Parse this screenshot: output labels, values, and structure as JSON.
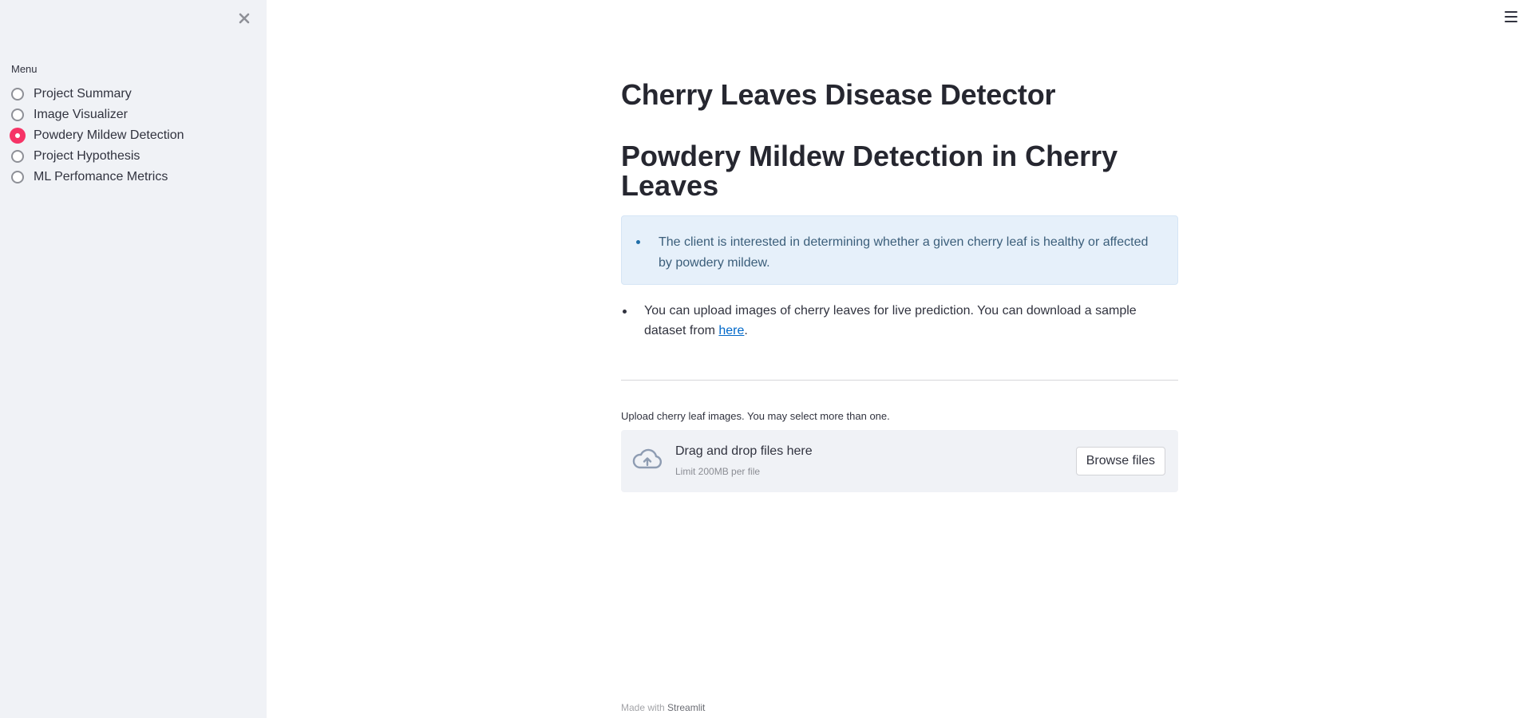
{
  "sidebar": {
    "close_icon": "close-icon",
    "menu_label": "Menu",
    "items": [
      {
        "label": "Project Summary",
        "selected": false
      },
      {
        "label": "Image Visualizer",
        "selected": false
      },
      {
        "label": "Powdery Mildew Detection",
        "selected": true
      },
      {
        "label": "Project Hypothesis",
        "selected": false
      },
      {
        "label": "ML Perfomance Metrics",
        "selected": false
      }
    ],
    "accent_color": "#f63366"
  },
  "header": {
    "menu_icon": "hamburger-menu-icon"
  },
  "main": {
    "title": "Cherry Leaves Disease Detector",
    "subtitle": "Powdery Mildew Detection in Cherry Leaves",
    "info_text": "The client is interested in determining whether a given cherry leaf is healthy or affected by powdery mildew.",
    "upload_note_prefix": "You can upload images of cherry leaves for live prediction. You can download a sample dataset from ",
    "upload_note_link": "here",
    "upload_note_suffix": ".",
    "uploader": {
      "label": "Upload cherry leaf images. You may select more than one.",
      "drag_text": "Drag and drop files here",
      "limit_text": "Limit 200MB per file",
      "browse_label": "Browse files",
      "icon": "cloud-upload-icon"
    }
  },
  "footer": {
    "prefix": "Made with ",
    "brand": "Streamlit"
  }
}
